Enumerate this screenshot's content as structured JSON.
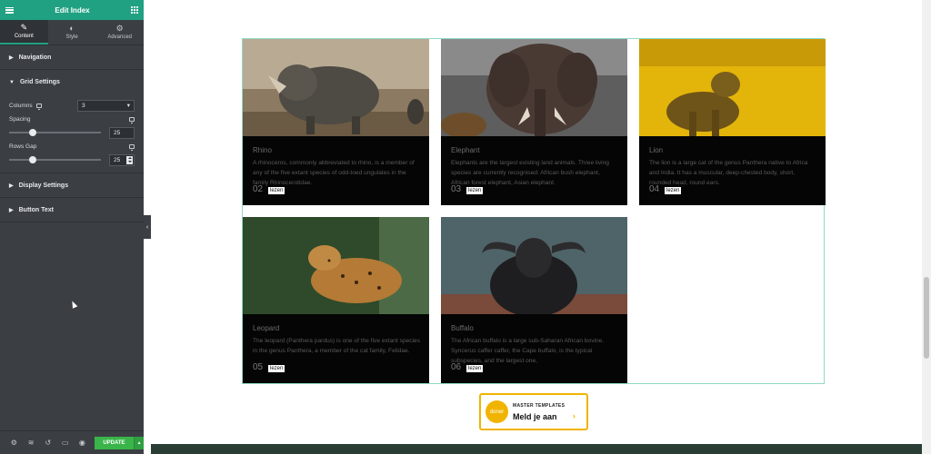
{
  "sidebar": {
    "title": "Edit Index",
    "tabs": [
      {
        "label": "Content",
        "icon": "pencil-icon"
      },
      {
        "label": "Style",
        "icon": "half-circle-icon"
      },
      {
        "label": "Advanced",
        "icon": "gear-icon"
      }
    ],
    "sections": {
      "navigation": "Navigation",
      "grid_settings": "Grid Settings",
      "display_settings": "Display Settings",
      "button_text": "Button Text"
    },
    "controls": {
      "columns_label": "Columns",
      "columns_value": "3",
      "spacing_label": "Spacing",
      "spacing_value": "25",
      "rows_gap_label": "Rows Gap",
      "rows_gap_value": "25"
    },
    "update_label": "UPDATE"
  },
  "cards": [
    {
      "name": "Rhino",
      "desc": "A rhinoceros, commonly abbreviated to rhino, is a member of any of the five extant species of odd-toed ungulates in the family Rhinocerotidae.",
      "num": "02",
      "button": "lezen"
    },
    {
      "name": "Elephant",
      "desc": "Elephants are the largest existing land animals. Three living species are currently recognised: African bush elephant, African forest elephant, Asian elephant.",
      "num": "03",
      "button": "lezen"
    },
    {
      "name": "Lion",
      "desc": "The lion is a large cat of the genus Panthera native to Africa and India. It has a muscular, deep-chested body, short, rounded head, round ears.",
      "num": "04",
      "button": "lezen"
    },
    {
      "name": "Leopard",
      "desc": "The leopard (Panthera pardus) is one of the five extant species in the genus Panthera, a member of the cat family, Felidae.",
      "num": "05",
      "button": "lezen"
    },
    {
      "name": "Buffalo",
      "desc": "The African buffalo is a large sub-Saharan African bovine. Syncerus caffer caffer, the Cape buffalo, is the typical subspecies, and the largest one,",
      "num": "06",
      "button": "lezen"
    }
  ],
  "cta": {
    "badge": "doner",
    "title": "MASTER TEMPLATES",
    "action": "Meld je aan"
  }
}
